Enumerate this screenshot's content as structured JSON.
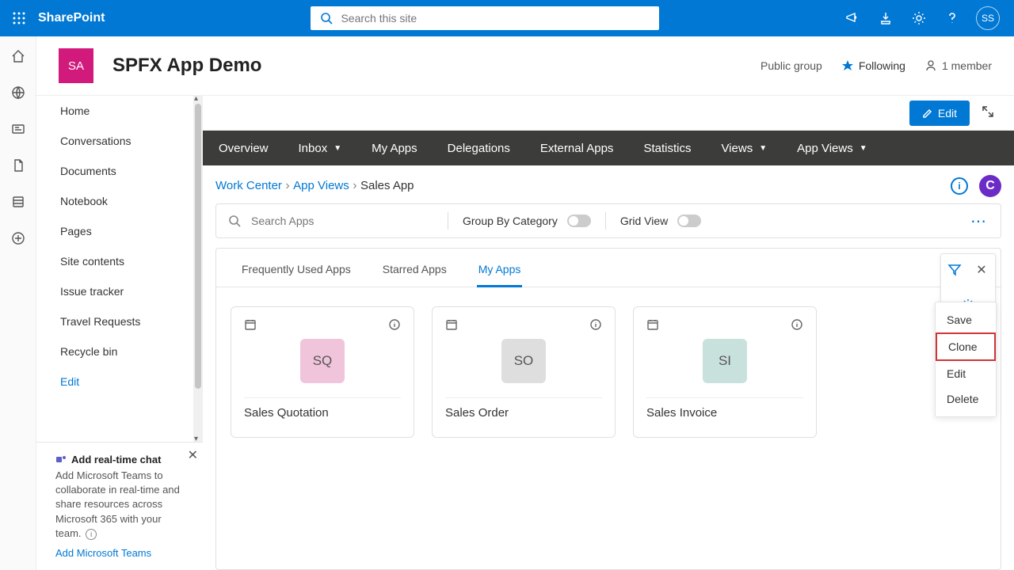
{
  "header": {
    "brand": "SharePoint",
    "search_placeholder": "Search this site",
    "avatar": "SS"
  },
  "site": {
    "logo_initials": "SA",
    "title": "SPFX App Demo",
    "group_type": "Public group",
    "following": "Following",
    "members": "1 member"
  },
  "sidebar": {
    "items": [
      {
        "label": "Home"
      },
      {
        "label": "Conversations"
      },
      {
        "label": "Documents"
      },
      {
        "label": "Notebook"
      },
      {
        "label": "Pages"
      },
      {
        "label": "Site contents"
      },
      {
        "label": "Issue tracker"
      },
      {
        "label": "Travel Requests"
      },
      {
        "label": "Recycle bin"
      },
      {
        "label": "Edit",
        "active": true
      }
    ],
    "chat": {
      "title": "Add real-time chat",
      "body": "Add Microsoft Teams to collaborate in real-time and share resources across Microsoft 365 with your team.",
      "link": "Add Microsoft Teams"
    }
  },
  "page": {
    "edit_label": "Edit",
    "dark_tabs": [
      {
        "label": "Overview"
      },
      {
        "label": "Inbox",
        "dropdown": true
      },
      {
        "label": "My Apps"
      },
      {
        "label": "Delegations"
      },
      {
        "label": "External Apps"
      },
      {
        "label": "Statistics"
      },
      {
        "label": "Views",
        "dropdown": true
      },
      {
        "label": "App Views",
        "dropdown": true
      }
    ],
    "breadcrumb": [
      {
        "label": "Work Center"
      },
      {
        "label": "App Views"
      },
      {
        "label": "Sales App",
        "current": true
      }
    ],
    "filter": {
      "search_placeholder": "Search Apps",
      "group_by": "Group By Category",
      "grid_view": "Grid View"
    },
    "inner_tabs": [
      {
        "label": "Frequently Used Apps"
      },
      {
        "label": "Starred Apps"
      },
      {
        "label": "My Apps",
        "active": true
      }
    ],
    "cards": [
      {
        "initials": "SQ",
        "title": "Sales Quotation",
        "bg": "#f0c4da"
      },
      {
        "initials": "SO",
        "title": "Sales Order",
        "bg": "#dedede"
      },
      {
        "initials": "SI",
        "title": "Sales Invoice",
        "bg": "#c9e1dc"
      }
    ],
    "context_menu": [
      {
        "label": "Save"
      },
      {
        "label": "Clone",
        "highlight": true
      },
      {
        "label": "Edit"
      },
      {
        "label": "Delete"
      }
    ],
    "purple_btn": "C"
  }
}
